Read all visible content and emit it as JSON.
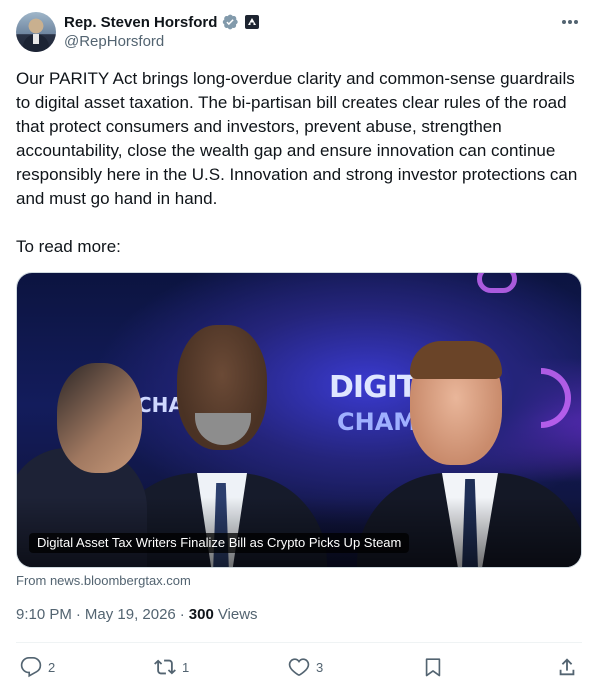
{
  "author": {
    "display_name": "Rep. Steven Horsford",
    "handle": "@RepHorsford"
  },
  "tweet": {
    "paragraphs": [
      "Our PARITY Act brings long-overdue clarity and common-sense guardrails to digital asset taxation. The bi-partisan bill creates clear rules of the road that protect consumers and investors, prevent abuse, strengthen accountability, close the wealth gap and ensure innovation can continue responsibly here in the U.S. Innovation and strong investor protections can and must go hand in hand.",
      "To read more:"
    ]
  },
  "card": {
    "caption": "Digital Asset Tax Writers Finalize Bill as Crypto Picks Up Steam",
    "source": "From news.bloombergtax.com",
    "stage_text_main": "DIGITA",
    "stage_text_sub": "CHAMB",
    "stage_text_left": "CHAI"
  },
  "meta": {
    "time": "9:10 PM",
    "separator": "·",
    "date": "May 19, 2026",
    "views_count": "300",
    "views_label": "Views"
  },
  "actions": {
    "replies": "2",
    "reposts": "1",
    "likes": "3"
  },
  "colors": {
    "text_primary": "#0f1419",
    "text_secondary": "#536471",
    "verified": "#829aab",
    "divider": "#eff3f4"
  },
  "icons": [
    "verified-badge-icon",
    "government-label-icon",
    "more-icon",
    "reply-icon",
    "repost-icon",
    "like-icon",
    "bookmark-icon",
    "share-icon"
  ]
}
